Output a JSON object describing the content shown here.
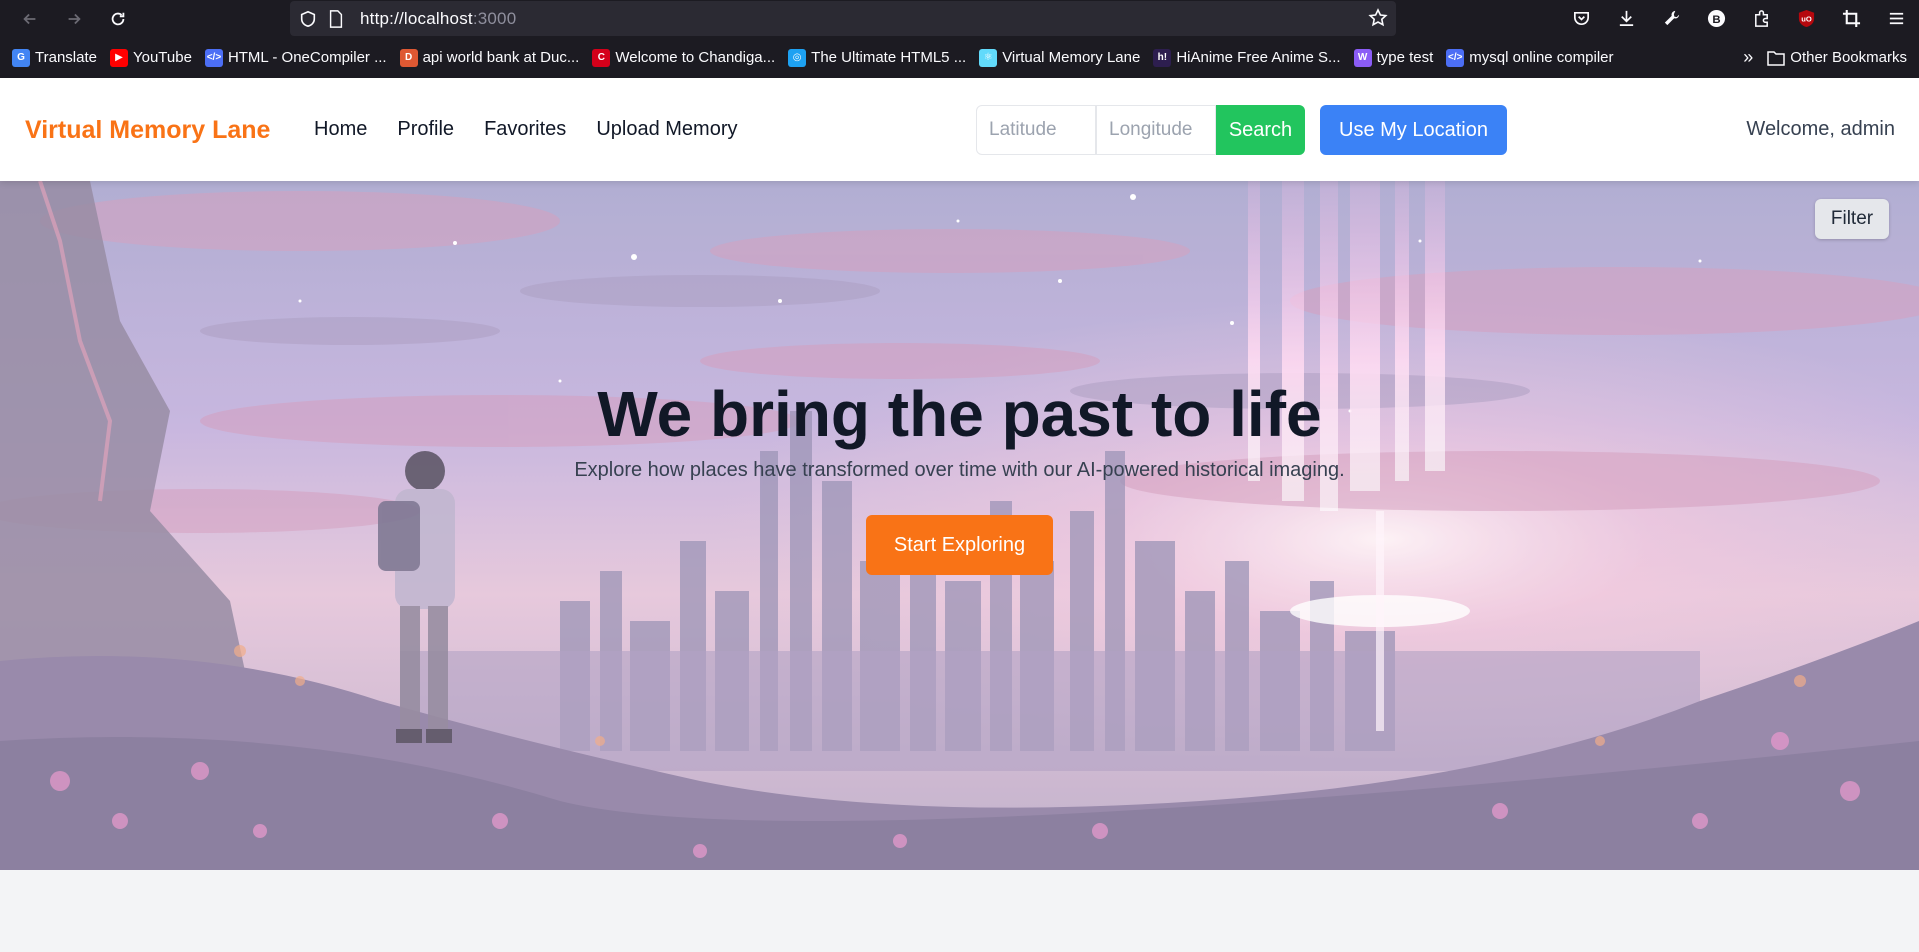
{
  "browser": {
    "url_host": "http://localhost",
    "url_port": ":3000",
    "icons": [
      "back-arrow-icon",
      "forward-arrow-icon",
      "reload-icon",
      "shield-icon",
      "page-icon",
      "star-icon",
      "pocket-icon",
      "download-icon",
      "wrench-icon",
      "extension-b-icon",
      "puzzle-icon",
      "ublock-icon",
      "crop-icon",
      "menu-icon"
    ]
  },
  "bookmarks": {
    "items": [
      {
        "label": "Translate",
        "color": "#4285f4",
        "glyph": "G"
      },
      {
        "label": "YouTube",
        "color": "#ff0000",
        "glyph": "▶"
      },
      {
        "label": "HTML - OneCompiler ...",
        "color": "#4c6ef5",
        "glyph": "</>"
      },
      {
        "label": "api world bank at Duc...",
        "color": "#de5833",
        "glyph": "D"
      },
      {
        "label": "Welcome to Chandiga...",
        "color": "#d4001a",
        "glyph": "C"
      },
      {
        "label": "The Ultimate HTML5 ...",
        "color": "#1da1f2",
        "glyph": "◎"
      },
      {
        "label": "Virtual Memory Lane",
        "color": "#61dafb",
        "glyph": "⚛"
      },
      {
        "label": "HiAnime Free Anime S...",
        "color": "#2d1e4f",
        "glyph": "h!"
      },
      {
        "label": "type test",
        "color": "#8b5cf6",
        "glyph": "W"
      },
      {
        "label": "mysql online compiler",
        "color": "#4c6ef5",
        "glyph": "</>"
      }
    ],
    "other": "Other Bookmarks"
  },
  "nav": {
    "brand": "Virtual Memory Lane",
    "links": [
      "Home",
      "Profile",
      "Favorites",
      "Upload Memory"
    ],
    "latitude_placeholder": "Latitude",
    "longitude_placeholder": "Longitude",
    "search_label": "Search",
    "location_label": "Use My Location",
    "welcome": "Welcome, admin"
  },
  "hero": {
    "filter_label": "Filter",
    "title": "We bring the past to life",
    "subtitle": "Explore how places have transformed over time with our AI-powered historical imaging.",
    "cta_label": "Start Exploring"
  },
  "colors": {
    "brand": "#f97316",
    "search": "#22c55e",
    "location": "#3b82f6"
  }
}
